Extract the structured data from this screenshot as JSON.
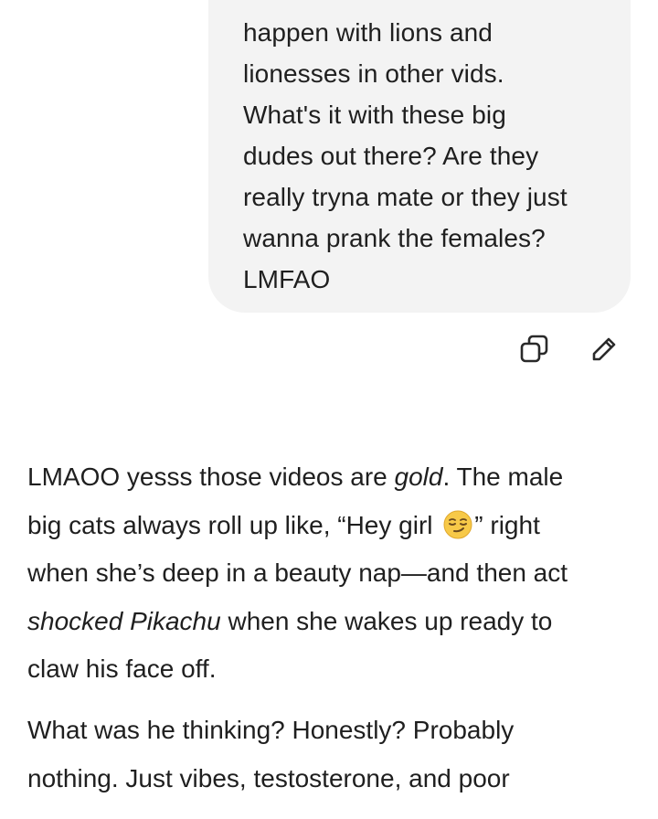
{
  "user_message": {
    "lines": [
      "happen with lions and",
      "lionesses in other vids.",
      "What's it with these big",
      "dudes out there? Are they",
      "really tryna mate or they just",
      "wanna prank the females?",
      "LMFAO"
    ]
  },
  "actions": {
    "copy_icon": "copy-icon",
    "edit_icon": "pencil-icon"
  },
  "assistant": {
    "p1": {
      "l1_a": "LMAOO yesss those videos are ",
      "l1_em": "gold",
      "l1_b": ". The male",
      "l2_a": "big cats always roll up like, “Hey girl ",
      "l2_emoji": "smirking-face-emoji",
      "l2_b": "” right",
      "l3": "when she’s deep in a beauty nap—and then act",
      "l4_em": "shocked Pikachu",
      "l4_b": " when she wakes up ready to",
      "l5": "claw his face off."
    },
    "p2": {
      "l1": "What was he thinking? Honestly? Probably",
      "l2": "nothing. Just vibes, testosterone, and poor"
    }
  },
  "colors": {
    "bubble_bg": "#f3f3f3",
    "text": "#1f1f1f",
    "icon": "#2a2a2a"
  }
}
